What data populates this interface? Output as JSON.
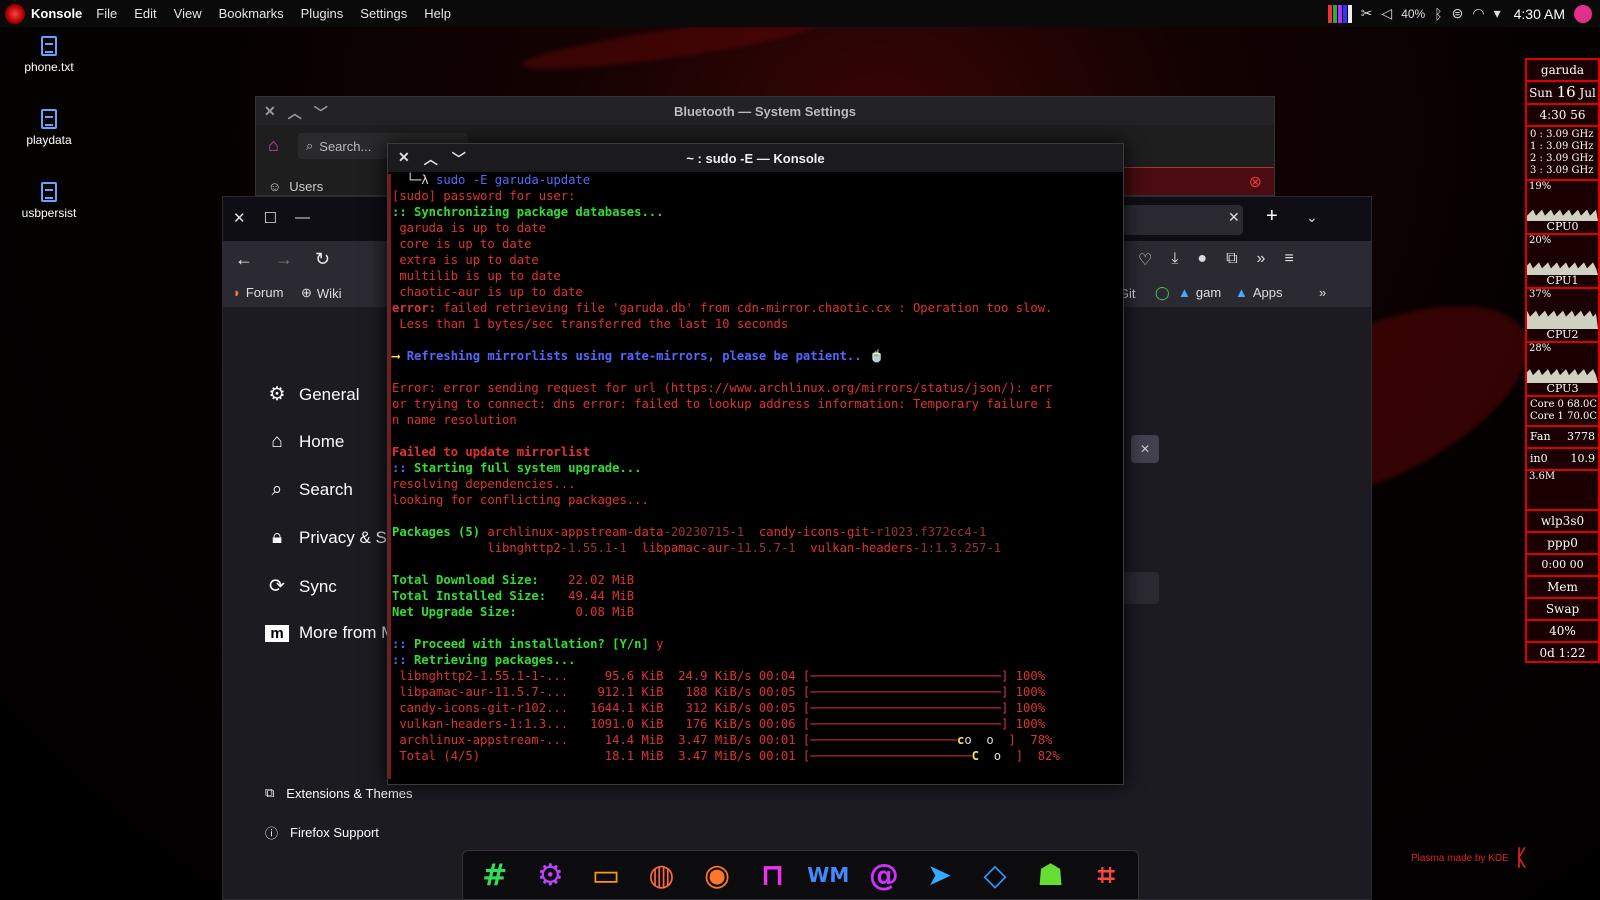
{
  "colors": {
    "accent": "#dd3333",
    "terminal_green": "#33dd33",
    "terminal_blue": "#5566ff",
    "conky_border": "#dd0000"
  },
  "top_panel": {
    "app_name": "Konsole",
    "menu": [
      "File",
      "Edit",
      "View",
      "Bookmarks",
      "Plugins",
      "Settings",
      "Help"
    ],
    "battery": "40%",
    "clock": "4:30 AM"
  },
  "desktop_icons": [
    "phone.txt",
    "playdata",
    "usbpersist"
  ],
  "bluetooth_window": {
    "title": "Bluetooth — System Settings",
    "search_placeholder": "Search...",
    "users_label": "Users"
  },
  "firefox": {
    "bookmarks": [
      "Forum",
      "Wiki",
      "Git",
      "gam",
      "Apps"
    ],
    "prefs": [
      "General",
      "Home",
      "Search",
      "Privacy & Se",
      "Sync",
      "More from M"
    ],
    "footer": [
      "Extensions & Themes",
      "Firefox Support"
    ]
  },
  "konsole": {
    "title": "~ : sudo -E — Konsole",
    "lines": [
      [
        [
          "c-white",
          "  └─λ "
        ],
        [
          "c-blue-n",
          "sudo"
        ],
        [
          "c-white",
          " "
        ],
        [
          "c-blue-n",
          "-E garuda-update"
        ]
      ],
      [
        [
          "c-red",
          "[sudo] password for user:"
        ]
      ],
      [
        [
          "c-green",
          ":: Synchronizing package databases..."
        ]
      ],
      [
        [
          "c-red",
          " garuda is up to date"
        ]
      ],
      [
        [
          "c-red",
          " core is up to date"
        ]
      ],
      [
        [
          "c-red",
          " extra is up to date"
        ]
      ],
      [
        [
          "c-red",
          " multilib is up to date"
        ]
      ],
      [
        [
          "c-red",
          " chaotic-aur is up to date"
        ]
      ],
      [
        [
          "c-wb",
          "error:"
        ],
        [
          "c-red",
          " failed retrieving file 'garuda.db' from cdn-mirror.chaotic.cx : Operation too slow."
        ]
      ],
      [
        [
          "c-red",
          " Less than 1 bytes/sec transferred the last 10 seconds"
        ]
      ],
      [
        [
          "c-red",
          ""
        ]
      ],
      [
        [
          "c-yellow",
          "⟶ "
        ],
        [
          "c-blue",
          "Refreshing mirrorlists using rate-mirrors, please be patient.."
        ],
        [
          "c-white",
          " 🍵"
        ]
      ],
      [
        [
          "c-red",
          ""
        ]
      ],
      [
        [
          "c-red",
          "Error: error sending request for url (https://www.archlinux.org/mirrors/status/json/): err"
        ]
      ],
      [
        [
          "c-red",
          "or trying to connect: dns error: failed to lookup address information: Temporary failure i"
        ]
      ],
      [
        [
          "c-red",
          "n name resolution"
        ]
      ],
      [
        [
          "c-red",
          ""
        ]
      ],
      [
        [
          "c-wb",
          "Failed to update mirrorlist"
        ]
      ],
      [
        [
          "c-blue",
          ":: "
        ],
        [
          "c-green",
          "Starting full system upgrade..."
        ]
      ],
      [
        [
          "c-red",
          "resolving dependencies..."
        ]
      ],
      [
        [
          "c-red",
          "looking for conflicting packages..."
        ]
      ],
      [
        [
          "c-red",
          ""
        ]
      ],
      [
        [
          "c-green",
          "Packages (5) "
        ],
        [
          "c-red",
          "archlinux-appstream-data"
        ],
        [
          "c-dim",
          "-20230715-1  "
        ],
        [
          "c-red",
          "candy-icons-git"
        ],
        [
          "c-dim",
          "-r1023.f372cc4-1"
        ]
      ],
      [
        [
          "c-red",
          "             libnghttp2"
        ],
        [
          "c-dim",
          "-1.55.1-1  "
        ],
        [
          "c-red",
          "libpamac-aur"
        ],
        [
          "c-dim",
          "-11.5.7-1  "
        ],
        [
          "c-red",
          "vulkan-headers"
        ],
        [
          "c-dim",
          "-1:1.3.257-1"
        ]
      ],
      [
        [
          "c-red",
          ""
        ]
      ],
      [
        [
          "c-green",
          "Total Download Size:  "
        ],
        [
          "c-red",
          "  22.02 MiB"
        ]
      ],
      [
        [
          "c-green",
          "Total Installed Size: "
        ],
        [
          "c-red",
          "  49.44 MiB"
        ]
      ],
      [
        [
          "c-green",
          "Net Upgrade Size:     "
        ],
        [
          "c-red",
          "   0.08 MiB"
        ]
      ],
      [
        [
          "c-red",
          ""
        ]
      ],
      [
        [
          "c-blue",
          ":: "
        ],
        [
          "c-green",
          "Proceed with installation? [Y/n]"
        ],
        [
          "c-red",
          " y"
        ]
      ],
      [
        [
          "c-blue",
          ":: "
        ],
        [
          "c-green",
          "Retrieving packages..."
        ]
      ],
      [
        [
          "c-red",
          " libnghttp2-1.55.1-1-...     95.6 KiB  24.9 KiB/s 00:04 [──────────────────────────] 100%"
        ]
      ],
      [
        [
          "c-red",
          " libpamac-aur-11.5.7-...    912.1 KiB   188 KiB/s 00:05 [──────────────────────────] 100%"
        ]
      ],
      [
        [
          "c-red",
          " candy-icons-git-r102...   1644.1 KiB   312 KiB/s 00:05 [──────────────────────────] 100%"
        ]
      ],
      [
        [
          "c-red",
          " vulkan-headers-1:1.3...   1091.0 KiB   176 KiB/s 00:06 [──────────────────────────] 100%"
        ]
      ],
      [
        [
          "c-red",
          " archlinux-appstream-...     14.4 MiB  3.47 MiB/s 00:01 [────────────────────"
        ],
        [
          "c-yellow",
          "c"
        ],
        [
          "c-white",
          "o  o  "
        ],
        [
          "c-red",
          "]  78%"
        ]
      ],
      [
        [
          "c-red",
          " Total (4/5)                 18.1 MiB  3.47 MiB/s 00:01 [──────────────────────"
        ],
        [
          "c-yellow",
          "C"
        ],
        [
          "c-white",
          "  o  "
        ],
        [
          "c-red",
          "]  82%"
        ]
      ]
    ]
  },
  "conky": {
    "host": "garuda",
    "day": "Sun",
    "date_num": "16",
    "month": "Jul",
    "time": "4:30 56",
    "freqs": [
      "0 : 3.09 GHz",
      "1 : 3.09 GHz",
      "2 : 3.09 GHz",
      "3 : 3.09 GHz"
    ],
    "cpus": [
      {
        "pct": "19%",
        "label": "CPU0",
        "level": 0.19
      },
      {
        "pct": "20%",
        "label": "CPU1",
        "level": 0.2
      },
      {
        "pct": "37%",
        "label": "CPU2",
        "level": 0.37
      },
      {
        "pct": "28%",
        "label": "CPU3",
        "level": 0.28
      }
    ],
    "temps": [
      "Core 0 68.0C",
      "Core 1 70.0C"
    ],
    "fan_label": "Fan",
    "fan_value": "3778",
    "in0_label": "in0",
    "in0_value": "10.9",
    "net_label": "3.6M",
    "wlp": "wlp3s0",
    "ppp": "ppp0",
    "net_time": "0:00  00",
    "mem": "Mem",
    "swap": "Swap",
    "battery": "40%",
    "uptime": "0d 1:22"
  },
  "dock_icons": [
    "hashtag-icon",
    "settings-gear-icon",
    "files-folder-icon",
    "firefox-icon",
    "garuda-dragon-icon",
    "store-bag-icon",
    "wm-icon",
    "at-app-icon",
    "telegram-icon",
    "kdeconnect-icon",
    "android-icon",
    "editor-icon"
  ],
  "plasma_note": "Plasma made by KDE"
}
